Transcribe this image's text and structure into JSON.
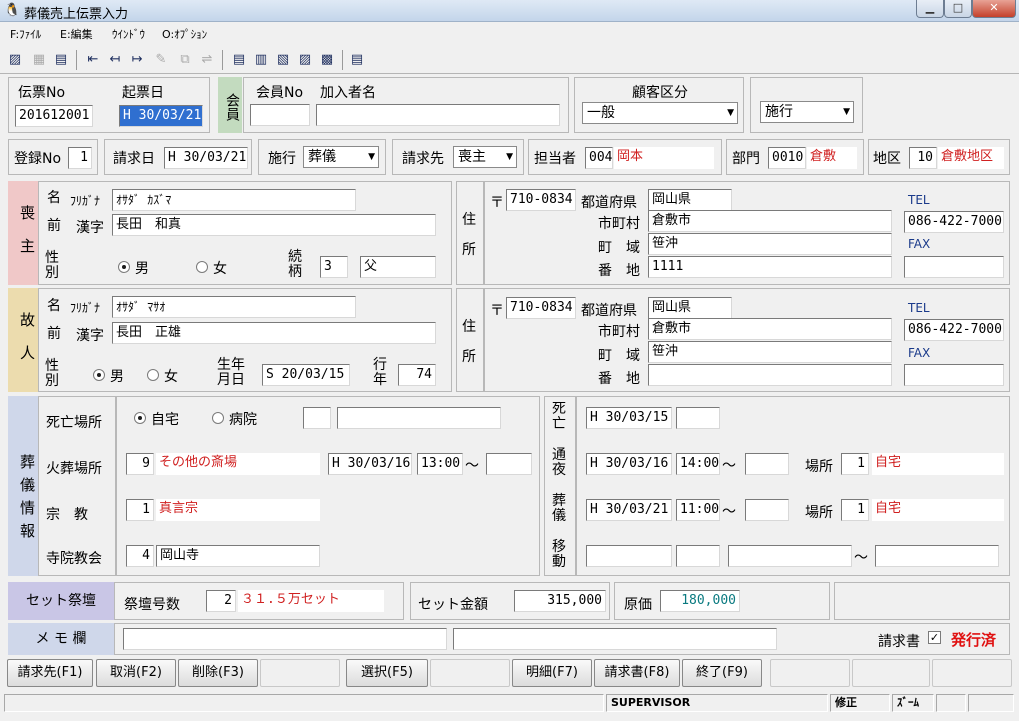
{
  "window": {
    "title": "葬儀売上伝票入力",
    "app_icon": "penguin-icon"
  },
  "menu": {
    "file": "F:ﾌｧｲﾙ",
    "edit": "E:編集",
    "window": "ｳｲﾝﾄﾞｳ",
    "option": "O:ｵﾌﾟｼｮﾝ"
  },
  "header": {
    "slip_no_label": "伝票No",
    "slip_no": "201612001",
    "date_label": "起票日",
    "date": "H 30/03/21",
    "member_side": "会員",
    "member_no_label": "会員No",
    "member_no": "",
    "subscriber_label": "加入者名",
    "subscriber": "",
    "customer_type_label": "顧客区分",
    "customer_type": "一般",
    "execution": "施行"
  },
  "row2": {
    "reg_no_label": "登録No",
    "reg_no": "1",
    "billing_date_label": "請求日",
    "billing_date": "H 30/03/21",
    "execution_label": "施行",
    "execution_value": "葬儀",
    "billing_to_label": "請求先",
    "billing_to": "喪主",
    "staff_label": "担当者",
    "staff_code": "004",
    "staff_name": "岡本",
    "dept_label": "部門",
    "dept_code": "0010",
    "dept_name": "倉敷",
    "area_label": "地区",
    "area_code": "10",
    "area_name": "倉敷地区"
  },
  "mourner": {
    "side": "喪主",
    "name_label_1": "名",
    "name_label_2": "前",
    "kana_label": "ﾌﾘｶﾞﾅ",
    "kana": "ｵｻﾀﾞ ｶｽﾞﾏ",
    "kanji_label": "漢字",
    "kanji": "長田　和真",
    "gender_label": "性別",
    "male": "男",
    "female": "女",
    "relation_label": "続柄",
    "relation_code": "3",
    "relation": "父",
    "address_label": "住所",
    "postal_mark": "〒",
    "postal": "710-0834",
    "pref_label": "都道府県",
    "pref": "岡山県",
    "city_label": "市町村",
    "city": "倉敷市",
    "area_label": "町　域",
    "area": "笹沖",
    "block_label": "番　地",
    "block": "1111",
    "tel_label": "TEL",
    "tel": "086-422-7000",
    "fax_label": "FAX",
    "fax": ""
  },
  "deceased": {
    "side": "故人",
    "name_label_1": "名",
    "name_label_2": "前",
    "kana_label": "ﾌﾘｶﾞﾅ",
    "kana": "ｵｻﾀﾞ ﾏｻｵ",
    "kanji_label": "漢字",
    "kanji": "長田　正雄",
    "gender_label": "性別",
    "male": "男",
    "female": "女",
    "birth_label": "生年月日",
    "birth": "S 20/03/15",
    "age_label": "行年",
    "age": "74",
    "address_label": "住所",
    "postal_mark": "〒",
    "postal": "710-0834",
    "pref_label": "都道府県",
    "pref": "岡山県",
    "city_label": "市町村",
    "city": "倉敷市",
    "area_label": "町　域",
    "area": "笹沖",
    "block_label": "番　地",
    "block": "",
    "tel_label": "TEL",
    "tel": "086-422-7000",
    "fax_label": "FAX",
    "fax": ""
  },
  "funeral": {
    "side": "葬儀情報",
    "death_place_label": "死亡場所",
    "home": "自宅",
    "hospital": "病院",
    "death_place_code": "",
    "death_place_name": "",
    "cremation_label": "火葬場所",
    "cremation_code": "9",
    "cremation_name": "その他の斎場",
    "cremation_date": "H 30/03/16",
    "cremation_time": "13:00",
    "cremation_end": "",
    "religion_label": "宗　教",
    "religion_code": "1",
    "religion_name": "真言宗",
    "temple_label": "寺院教会",
    "temple_code": "4",
    "temple_name": "岡山寺",
    "death_label": "死亡",
    "death_date": "H 30/03/15",
    "death_time": "",
    "wake_label": "通夜",
    "wake_date": "H 30/03/16",
    "wake_time": "14:00",
    "wake_end": "",
    "wake_place_label": "場所",
    "wake_place_code": "1",
    "wake_place": "自宅",
    "funeral_label": "葬儀",
    "funeral_date": "H 30/03/21",
    "funeral_time": "11:00",
    "funeral_end": "",
    "funeral_place_label": "場所",
    "funeral_place_code": "1",
    "funeral_place": "自宅",
    "move_label": "移動",
    "tilde": "～"
  },
  "set": {
    "label": "セット祭壇",
    "altar_no_label": "祭壇号数",
    "altar_code": "2",
    "altar_name": "３１.５万セット",
    "amount_label": "セット金額",
    "amount": "315,000",
    "cost_label": "原価",
    "cost": "180,000"
  },
  "memo": {
    "label": "メ モ 欄",
    "memo1": "",
    "memo2": "",
    "invoice_label": "請求書",
    "issued": "発行済"
  },
  "fkeys": [
    "請求先(F1)",
    "取消(F2)",
    "削除(F3)",
    "",
    "選択(F5)",
    "",
    "明細(F7)",
    "請求書(F8)",
    "終了(F9)",
    "",
    "",
    ""
  ],
  "statusbar": {
    "user": "SUPERVISOR",
    "mode": "修正",
    "zoom": "ｽﾞｰﾑ"
  }
}
